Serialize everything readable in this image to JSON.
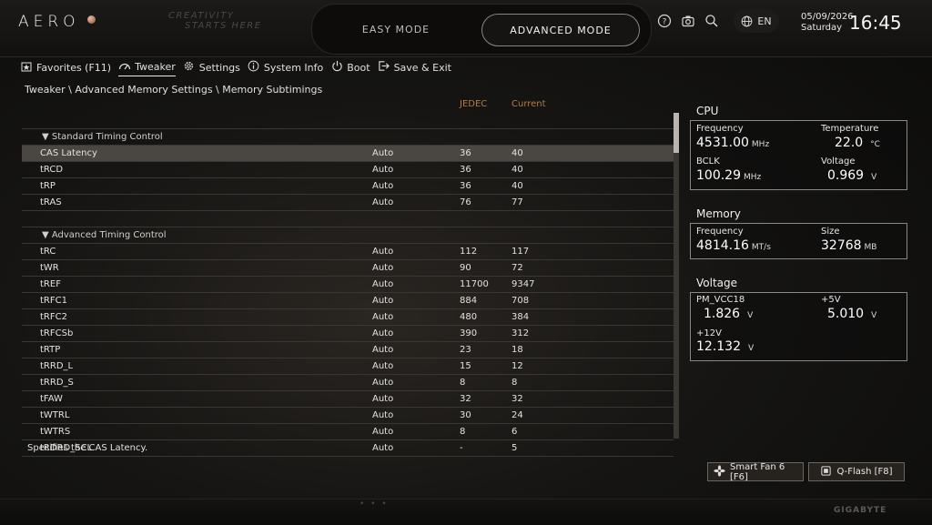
{
  "header": {
    "logo": "AERO",
    "tagline_line1": "CREATIVITY",
    "tagline_line2": "STARTS HERE",
    "mode_easy": "EASY MODE",
    "mode_advanced": "ADVANCED MODE",
    "language": "EN",
    "date": "05/09/2026",
    "day": "Saturday",
    "time": "16:45"
  },
  "nav": [
    {
      "label": "Favorites (F11)",
      "icon": "star-icon",
      "active": false
    },
    {
      "label": "Tweaker",
      "icon": "speedometer-icon",
      "active": true
    },
    {
      "label": "Settings",
      "icon": "gear-icon",
      "active": false
    },
    {
      "label": "System Info",
      "icon": "info-icon",
      "active": false
    },
    {
      "label": "Boot",
      "icon": "power-icon",
      "active": false
    },
    {
      "label": "Save & Exit",
      "icon": "exit-icon",
      "active": false
    }
  ],
  "breadcrumb": "Tweaker \\ Advanced Memory Settings \\ Memory Subtimings",
  "table": {
    "col_jedec": "JEDEC",
    "col_current": "Current",
    "rows": [
      {
        "type": "spacer"
      },
      {
        "type": "section",
        "name": "▼ Standard Timing Control"
      },
      {
        "type": "item",
        "name": "CAS Latency",
        "value": "Auto",
        "jedec": "36",
        "current": "40",
        "selected": true
      },
      {
        "type": "item",
        "name": "tRCD",
        "value": "Auto",
        "jedec": "36",
        "current": "40"
      },
      {
        "type": "item",
        "name": "tRP",
        "value": "Auto",
        "jedec": "36",
        "current": "40"
      },
      {
        "type": "item",
        "name": "tRAS",
        "value": "Auto",
        "jedec": "76",
        "current": "77"
      },
      {
        "type": "spacer"
      },
      {
        "type": "section",
        "name": "▼ Advanced Timing Control"
      },
      {
        "type": "item",
        "name": "tRC",
        "value": "Auto",
        "jedec": "112",
        "current": "117"
      },
      {
        "type": "item",
        "name": "tWR",
        "value": "Auto",
        "jedec": "90",
        "current": "72"
      },
      {
        "type": "item",
        "name": "tREF",
        "value": "Auto",
        "jedec": "11700",
        "current": "9347"
      },
      {
        "type": "item",
        "name": "tRFC1",
        "value": "Auto",
        "jedec": "884",
        "current": "708"
      },
      {
        "type": "item",
        "name": "tRFC2",
        "value": "Auto",
        "jedec": "480",
        "current": "384"
      },
      {
        "type": "item",
        "name": "tRFCSb",
        "value": "Auto",
        "jedec": "390",
        "current": "312"
      },
      {
        "type": "item",
        "name": "tRTP",
        "value": "Auto",
        "jedec": "23",
        "current": "18"
      },
      {
        "type": "item",
        "name": "tRRD_L",
        "value": "Auto",
        "jedec": "15",
        "current": "12"
      },
      {
        "type": "item",
        "name": "tRRD_S",
        "value": "Auto",
        "jedec": "8",
        "current": "8"
      },
      {
        "type": "item",
        "name": "tFAW",
        "value": "Auto",
        "jedec": "32",
        "current": "32"
      },
      {
        "type": "item",
        "name": "tWTRL",
        "value": "Auto",
        "jedec": "30",
        "current": "24"
      },
      {
        "type": "item",
        "name": "tWTRS",
        "value": "Auto",
        "jedec": "8",
        "current": "6"
      },
      {
        "type": "item",
        "name": "tRDRD_SCL",
        "value": "Auto",
        "jedec": "-",
        "current": "5"
      }
    ]
  },
  "help_text": "Specifies the CAS Latency.",
  "cpu": {
    "title": "CPU",
    "freq_label": "Frequency",
    "freq_value": "4531.00",
    "freq_unit": "MHz",
    "temp_label": "Temperature",
    "temp_value": "22.0",
    "temp_unit": "°C",
    "bclk_label": "BCLK",
    "bclk_value": "100.29",
    "bclk_unit": "MHz",
    "volt_label": "Voltage",
    "volt_value": "0.969",
    "volt_unit": "V"
  },
  "memory": {
    "title": "Memory",
    "freq_label": "Frequency",
    "freq_value": "4814.16",
    "freq_unit": "MT/s",
    "size_label": "Size",
    "size_value": "32768",
    "size_unit": "MB"
  },
  "voltage": {
    "title": "Voltage",
    "pm_label": "PM_VCC18",
    "pm_value": "1.826",
    "pm_unit": "V",
    "v5_label": "+5V",
    "v5_value": "5.010",
    "v5_unit": "V",
    "v12_label": "+12V",
    "v12_value": "12.132",
    "v12_unit": "V"
  },
  "footer": {
    "smartfan": "Smart Fan 6 [F6]",
    "qflash": "Q-Flash [F8]",
    "brand": "GIGABYTE"
  }
}
